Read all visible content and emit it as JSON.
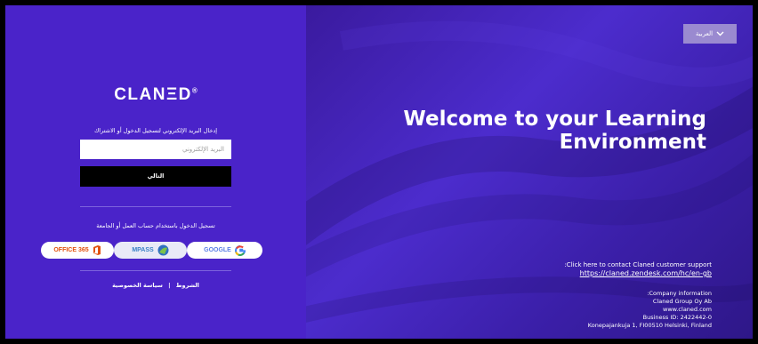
{
  "logo": {
    "text": "CLANΞD",
    "mark": "®"
  },
  "signin": {
    "intro": "إدخال البريد الإلكتروني لتسجيل الدخول أو الاشتراك",
    "email_placeholder": "البريد الإلكتروني",
    "next_label": "التالي",
    "sso_note": "تسجيل الدخول باستخدام حساب العمل أو الجامعة"
  },
  "sso": {
    "office365": "OFFICE 365",
    "mpass": "MPASS",
    "google": "GOOGLE"
  },
  "footer_links": {
    "privacy": "سياسة الخصوصية",
    "separator": "|",
    "terms": "الشروط"
  },
  "language": {
    "label": "العربية"
  },
  "hero": {
    "line1": "Welcome to your Learning",
    "line2": "Environment"
  },
  "support": {
    "text": ":Click here to contact Claned customer support",
    "link": "https://claned.zendesk.com/hc/en-gb"
  },
  "company": {
    "title": ":Company information",
    "name": "Claned Group Oy Ab",
    "website": "www.claned.com",
    "business_id": "Business ID: 2422442-0",
    "address": "Konepajankuja 1, FI00510 Helsinki, Finland"
  },
  "colors": {
    "panel": "#4a23c9",
    "accent_dark": "#000000",
    "office": "#e2520e",
    "google_blue": "#4285f4"
  }
}
